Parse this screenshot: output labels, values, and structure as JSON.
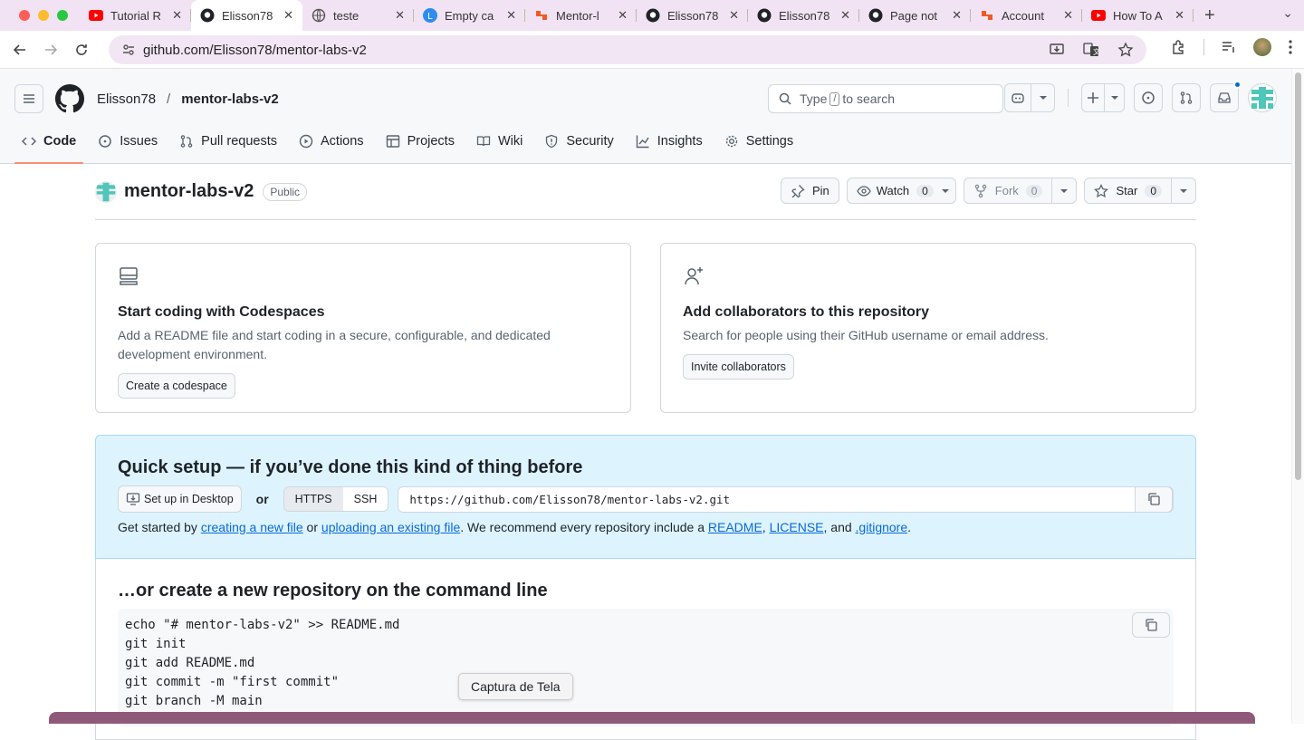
{
  "browser": {
    "tabs": [
      {
        "title": "Tutorial R",
        "icon": "youtube-icon"
      },
      {
        "title": "Elisson78",
        "icon": "github-icon",
        "active": true
      },
      {
        "title": "teste",
        "icon": "globe-icon"
      },
      {
        "title": "Empty ca",
        "icon": "loom-icon"
      },
      {
        "title": "Mentor-l",
        "icon": "orange-app-icon"
      },
      {
        "title": "Elisson78",
        "icon": "github-icon"
      },
      {
        "title": "Elisson78",
        "icon": "github-icon"
      },
      {
        "title": "Page not",
        "icon": "github-icon"
      },
      {
        "title": "Account",
        "icon": "orange-app-icon"
      },
      {
        "title": "How To A",
        "icon": "youtube-icon"
      }
    ],
    "url": "github.com/Elisson78/mentor-labs-v2"
  },
  "github": {
    "owner": "Elisson78",
    "separator": "/",
    "repo": "mentor-labs-v2",
    "search_pre": "Type",
    "search_key": "/",
    "search_post": "to search",
    "repo_tabs": [
      "Code",
      "Issues",
      "Pull requests",
      "Actions",
      "Projects",
      "Wiki",
      "Security",
      "Insights",
      "Settings"
    ]
  },
  "repo_header": {
    "name": "mentor-labs-v2",
    "visibility": "Public",
    "pin": "Pin",
    "watch": "Watch",
    "watch_count": "0",
    "fork": "Fork",
    "fork_count": "0",
    "star": "Star",
    "star_count": "0"
  },
  "cards": {
    "codespaces": {
      "title": "Start coding with Codespaces",
      "desc": "Add a README file and start coding in a secure, configurable, and dedicated development environment.",
      "button": "Create a codespace"
    },
    "collab": {
      "title": "Add collaborators to this repository",
      "desc": "Search for people using their GitHub username or email address.",
      "button": "Invite collaborators"
    }
  },
  "quick_setup": {
    "title": "Quick setup — if you’ve done this kind of thing before",
    "desktop_btn": "Set up in Desktop",
    "or": "or",
    "https": "HTTPS",
    "ssh": "SSH",
    "clone_url": "https://github.com/Elisson78/mentor-labs-v2.git",
    "text_1": "Get started by ",
    "link_new": "creating a new file",
    "text_2": " or ",
    "link_upload": "uploading an existing file",
    "text_3": ". We recommend every repository include a ",
    "link_readme": "README",
    "text_4": ", ",
    "link_license": "LICENSE",
    "text_5": ", and ",
    "link_gitignore": ".gitignore",
    "text_6": "."
  },
  "command_line": {
    "title": "…or create a new repository on the command line",
    "lines": [
      "echo \"# mentor-labs-v2\" >> README.md",
      "git init",
      "git add README.md",
      "git commit -m \"first commit\"",
      "git branch -M main"
    ]
  },
  "tooltip": "Captura de Tela",
  "colors": {
    "accent_link": "#0969da",
    "quick_bg": "#ddf4ff",
    "selected_tab_underline": "#fd8c73"
  }
}
